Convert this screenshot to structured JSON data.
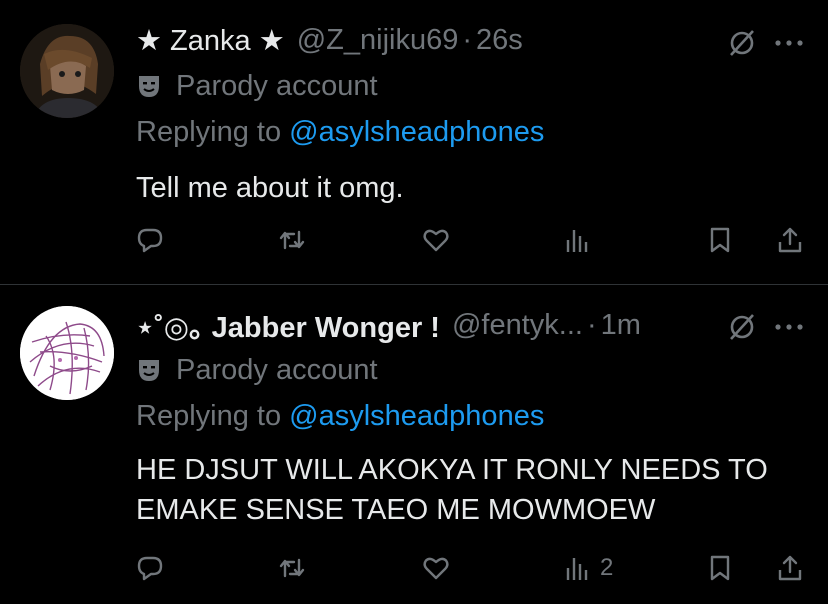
{
  "tweets": [
    {
      "name": "★ Zanka ★",
      "handle": "@Z_nijiku69",
      "separator": "·",
      "time": "26s",
      "parody_label": "Parody account",
      "replying_prefix": "Replying to ",
      "replying_to": "@asylsheadphones",
      "text": "Tell me about it omg.",
      "views": ""
    },
    {
      "name": "⋆˚◎｡ Jabber Wonger !",
      "handle": "@fentyk...",
      "separator": "·",
      "time": "1m",
      "parody_label": "Parody account",
      "replying_prefix": "Replying to ",
      "replying_to": "@asylsheadphones",
      "text": "HE DJSUT WILL AKOKYA IT RONLY NEEDS TO EMAKE SENSE TAEO ME MOWMOEW",
      "views": "2"
    }
  ],
  "icons": {
    "reply": "comment-icon",
    "retweet": "retweet-icon",
    "like": "heart-icon",
    "views": "analytics-icon",
    "bookmark": "bookmark-icon",
    "share": "share-icon",
    "mute": "muted-icon",
    "more": "more-icon",
    "parody": "mask-icon"
  },
  "colors": {
    "background": "#000000",
    "text": "#e7e9ea",
    "muted": "#71767b",
    "link": "#1d9bf0",
    "divider": "#2f3336"
  }
}
